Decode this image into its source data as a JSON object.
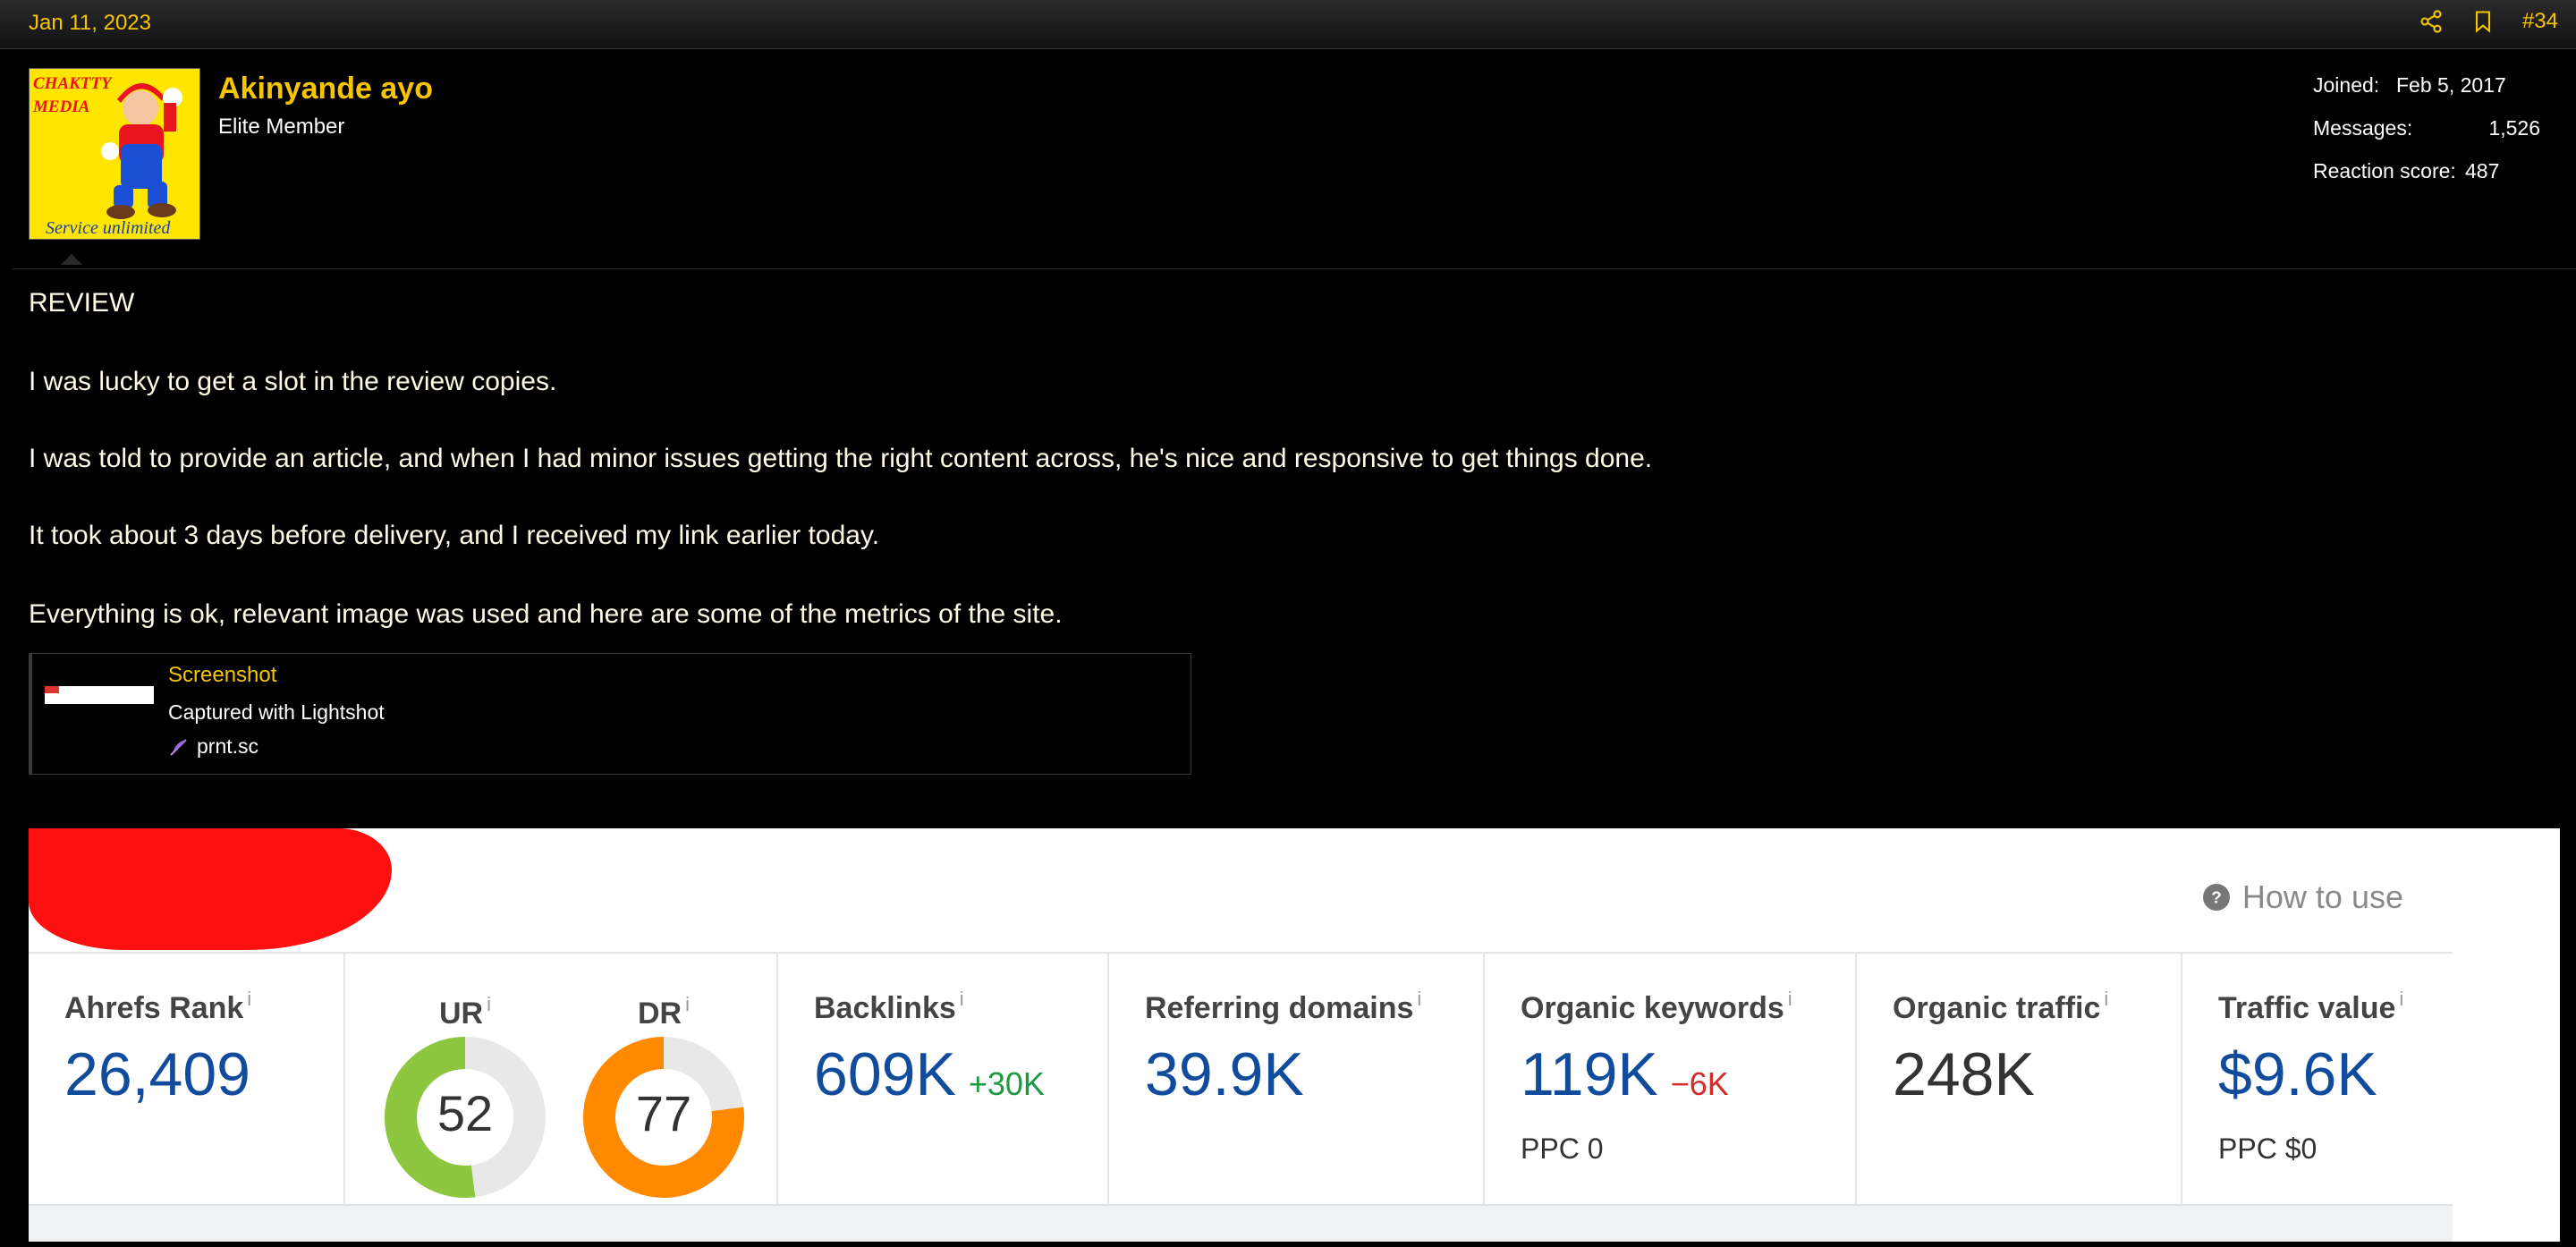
{
  "post": {
    "date": "Jan 11, 2023",
    "number": "#34",
    "actions": [
      "share-icon",
      "bookmark-icon"
    ]
  },
  "user": {
    "name": "Akinyande ayo",
    "title": "Elite Member",
    "avatar_text": [
      "CHAKTTY",
      "MEDIA",
      "Service unlimited"
    ],
    "stats": [
      {
        "label": "Joined:",
        "value": "Feb 5, 2017"
      },
      {
        "label": "Messages:",
        "value": "1,526"
      },
      {
        "label": "Reaction score:",
        "value": "487"
      }
    ]
  },
  "body": {
    "heading": "REVIEW",
    "paragraphs": [
      "I was lucky to get a slot in the review copies.",
      "I was told to provide an article, and when I had minor issues getting the right content across, he's nice and responsive to get things done.",
      "It took about 3 days before delivery, and I received my link earlier today.",
      "Everything is ok, relevant image was used and here are some of the metrics of the site."
    ]
  },
  "embed": {
    "title": "Screenshot",
    "description": "Captured with Lightshot",
    "site": "prnt.sc"
  },
  "ahrefs": {
    "how_to_use": "How to use",
    "info_marker": "i",
    "metrics": {
      "ahrefs_rank": {
        "label": "Ahrefs Rank",
        "value": "26,409"
      },
      "ur": {
        "label": "UR",
        "value": "52",
        "level": 52,
        "color": "#8dc63f"
      },
      "dr": {
        "label": "DR",
        "value": "77",
        "level": 77,
        "color": "#ff8a00"
      },
      "backlinks": {
        "label": "Backlinks",
        "value": "609K",
        "delta": "+30K"
      },
      "referring_domains": {
        "label": "Referring domains",
        "value": "39.9K"
      },
      "organic_keywords": {
        "label": "Organic keywords",
        "value": "119K",
        "delta": "−6K",
        "sub": "PPC 0"
      },
      "organic_traffic": {
        "label": "Organic traffic",
        "value": "248K"
      },
      "traffic_value": {
        "label": "Traffic value",
        "value": "$9.6K",
        "sub": "PPC $0"
      }
    }
  },
  "colors": {
    "accent": "#f7c600",
    "ahrefs_blue": "#114b9c",
    "delta_up": "#1a9a43",
    "delta_down": "#d42b2b",
    "redaction": "#ff1010"
  }
}
